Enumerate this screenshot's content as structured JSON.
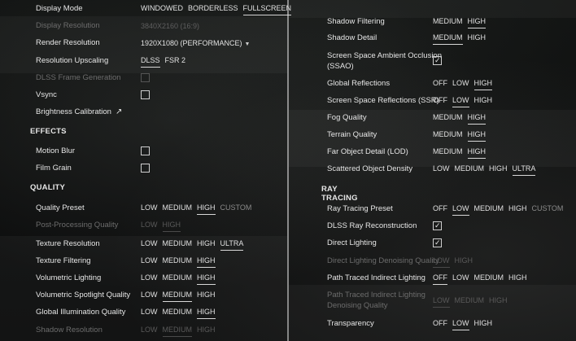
{
  "left": {
    "display_mode": {
      "label": "Display Mode",
      "options": [
        "WINDOWED",
        "BORDERLESS",
        "FULLSCREEN"
      ],
      "selected": "FULLSCREEN"
    },
    "display_resolution": {
      "label": "Display Resolution",
      "value": "3840X2160 (16:9)"
    },
    "render_resolution": {
      "label": "Render Resolution",
      "value": "1920X1080 (PERFORMANCE)"
    },
    "resolution_upscaling": {
      "label": "Resolution Upscaling",
      "options": [
        "DLSS",
        "FSR 2"
      ],
      "selected": "DLSS"
    },
    "dlss_frame_generation": {
      "label": "DLSS Frame Generation"
    },
    "vsync": {
      "label": "Vsync"
    },
    "brightness_calibration": {
      "label": "Brightness Calibration"
    },
    "effects_header": "EFFECTS",
    "motion_blur": {
      "label": "Motion Blur"
    },
    "film_grain": {
      "label": "Film Grain"
    },
    "quality_header": "QUALITY",
    "quality_preset": {
      "label": "Quality Preset",
      "options": [
        "LOW",
        "MEDIUM",
        "HIGH",
        "CUSTOM"
      ],
      "selected": "HIGH"
    },
    "post_processing_quality": {
      "label": "Post-Processing Quality",
      "options": [
        "LOW",
        "HIGH"
      ],
      "selected": "HIGH"
    },
    "texture_resolution": {
      "label": "Texture Resolution",
      "options": [
        "LOW",
        "MEDIUM",
        "HIGH",
        "ULTRA"
      ],
      "selected": "ULTRA"
    },
    "texture_filtering": {
      "label": "Texture Filtering",
      "options": [
        "LOW",
        "MEDIUM",
        "HIGH"
      ],
      "selected": "HIGH"
    },
    "volumetric_lighting": {
      "label": "Volumetric Lighting",
      "options": [
        "LOW",
        "MEDIUM",
        "HIGH"
      ],
      "selected": "HIGH"
    },
    "volumetric_spotlight_quality": {
      "label": "Volumetric Spotlight Quality",
      "options": [
        "LOW",
        "MEDIUM",
        "HIGH"
      ],
      "selected": "MEDIUM"
    },
    "global_illumination_quality": {
      "label": "Global Illumination Quality",
      "options": [
        "LOW",
        "MEDIUM",
        "HIGH"
      ],
      "selected": "HIGH"
    },
    "shadow_resolution": {
      "label": "Shadow Resolution",
      "options": [
        "LOW",
        "MEDIUM",
        "HIGH"
      ],
      "selected": "MEDIUM"
    }
  },
  "right": {
    "shadow_filtering": {
      "label": "Shadow Filtering",
      "options": [
        "MEDIUM",
        "HIGH"
      ],
      "selected": "HIGH"
    },
    "shadow_detail": {
      "label": "Shadow Detail",
      "options": [
        "MEDIUM",
        "HIGH"
      ],
      "selected": "MEDIUM"
    },
    "ssao": {
      "label_line1": "Screen Space Ambient Occlusion",
      "label_line2": "(SSAO)"
    },
    "global_reflections": {
      "label": "Global Reflections",
      "options": [
        "OFF",
        "LOW",
        "HIGH"
      ],
      "selected": "HIGH"
    },
    "ssr": {
      "label": "Screen Space Reflections (SSR)",
      "options": [
        "OFF",
        "LOW",
        "HIGH"
      ],
      "selected": "LOW"
    },
    "fog_quality": {
      "label": "Fog Quality",
      "options": [
        "MEDIUM",
        "HIGH"
      ],
      "selected": "HIGH"
    },
    "terrain_quality": {
      "label": "Terrain Quality",
      "options": [
        "MEDIUM",
        "HIGH"
      ],
      "selected": "HIGH"
    },
    "far_object_detail": {
      "label": "Far Object Detail (LOD)",
      "options": [
        "MEDIUM",
        "HIGH"
      ],
      "selected": "HIGH"
    },
    "scattered_object_density": {
      "label": "Scattered Object Density",
      "options": [
        "LOW",
        "MEDIUM",
        "HIGH",
        "ULTRA"
      ],
      "selected": "ULTRA"
    },
    "ray_tracing_header": "RAY TRACING",
    "ray_tracing_preset": {
      "label": "Ray Tracing Preset",
      "options": [
        "OFF",
        "LOW",
        "MEDIUM",
        "HIGH",
        "CUSTOM"
      ],
      "selected": "LOW"
    },
    "dlss_ray_reconstruction": {
      "label": "DLSS Ray Reconstruction"
    },
    "direct_lighting": {
      "label": "Direct Lighting"
    },
    "direct_lighting_denoising": {
      "label": "Direct Lighting Denoising Quality",
      "options": [
        "LOW",
        "HIGH"
      ],
      "selected": "LOW"
    },
    "path_traced_indirect_lighting": {
      "label": "Path Traced Indirect Lighting",
      "options": [
        "OFF",
        "LOW",
        "MEDIUM",
        "HIGH"
      ],
      "selected": "OFF"
    },
    "path_traced_denoising": {
      "label_line1": "Path Traced Indirect Lighting",
      "label_line2": "Denoising Quality",
      "options": [
        "LOW",
        "MEDIUM",
        "HIGH"
      ],
      "selected": "LOW"
    },
    "transparency": {
      "label": "Transparency",
      "options": [
        "OFF",
        "LOW",
        "HIGH"
      ],
      "selected": "LOW"
    }
  },
  "icons": {
    "external_link": "external-link-icon",
    "dropdown": "caret-down-icon",
    "check": "checkmark-icon"
  }
}
